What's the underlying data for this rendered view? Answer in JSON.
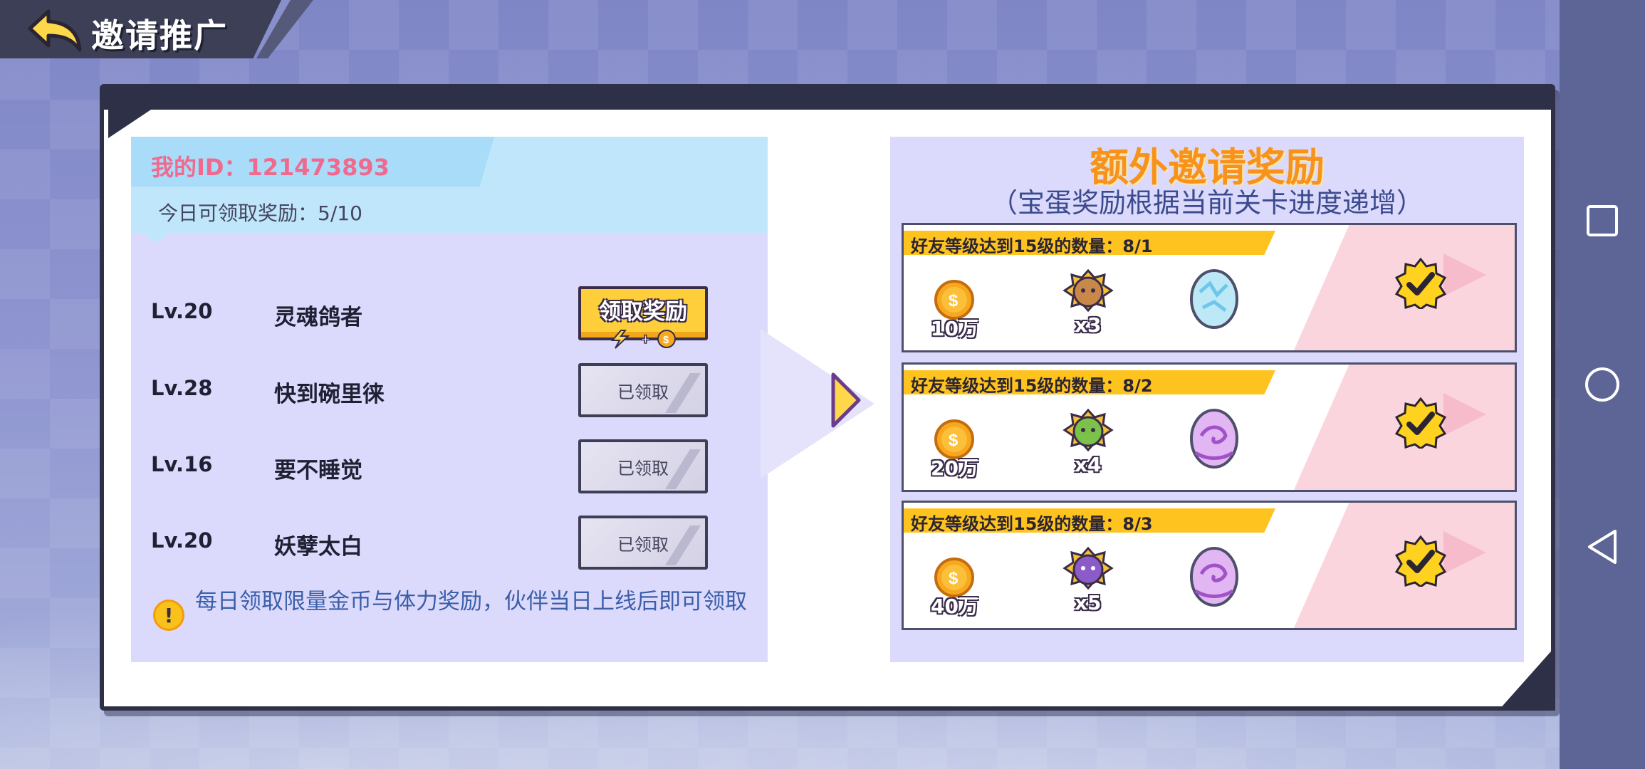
{
  "header": {
    "title": "邀请推广"
  },
  "left": {
    "my_id_label": "我的ID：121473893",
    "today_reward": "今日可领取奖励：5/10",
    "friends": [
      {
        "level": "Lv.20",
        "name": "灵魂鸽者",
        "button": "领取奖励",
        "claimed": false
      },
      {
        "level": "Lv.28",
        "name": "快到碗里徕",
        "button": "已领取",
        "claimed": true
      },
      {
        "level": "Lv.16",
        "name": "要不睡觉",
        "button": "已领取",
        "claimed": true
      },
      {
        "level": "Lv.20",
        "name": "妖孽太白",
        "button": "已领取",
        "claimed": true
      }
    ],
    "tip": "每日领取限量金币与体力奖励，伙伴当日上线后即可领取"
  },
  "right": {
    "title": "额外邀请奖励",
    "subtitle": "（宝蛋奖励根据当前关卡进度递增）",
    "rewards": [
      {
        "condition": "好友等级达到15级的数量：8/1",
        "coins": "10万",
        "hero_count": "x3",
        "egg": "ice-egg",
        "completed": true
      },
      {
        "condition": "好友等级达到15级的数量：8/2",
        "coins": "20万",
        "hero_count": "x4",
        "egg": "purple-egg",
        "completed": true
      },
      {
        "condition": "好友等级达到15级的数量：8/3",
        "coins": "40万",
        "hero_count": "x5",
        "egg": "purple-egg",
        "completed": true
      }
    ]
  },
  "colors": {
    "id_pink": "#f0698e",
    "title_orange": "#f7931d",
    "ribbon_yellow": "#ffc31f",
    "panel_lavender": "#dcdafc",
    "tip_blue": "#3b5fa9"
  },
  "icons": [
    "back-arrow-icon",
    "coin-icon",
    "hero-shard-icon",
    "egg-icon",
    "check-badge-icon",
    "warning-icon",
    "next-arrow-icon",
    "square-nav-icon",
    "circle-nav-icon",
    "triangle-nav-icon"
  ]
}
